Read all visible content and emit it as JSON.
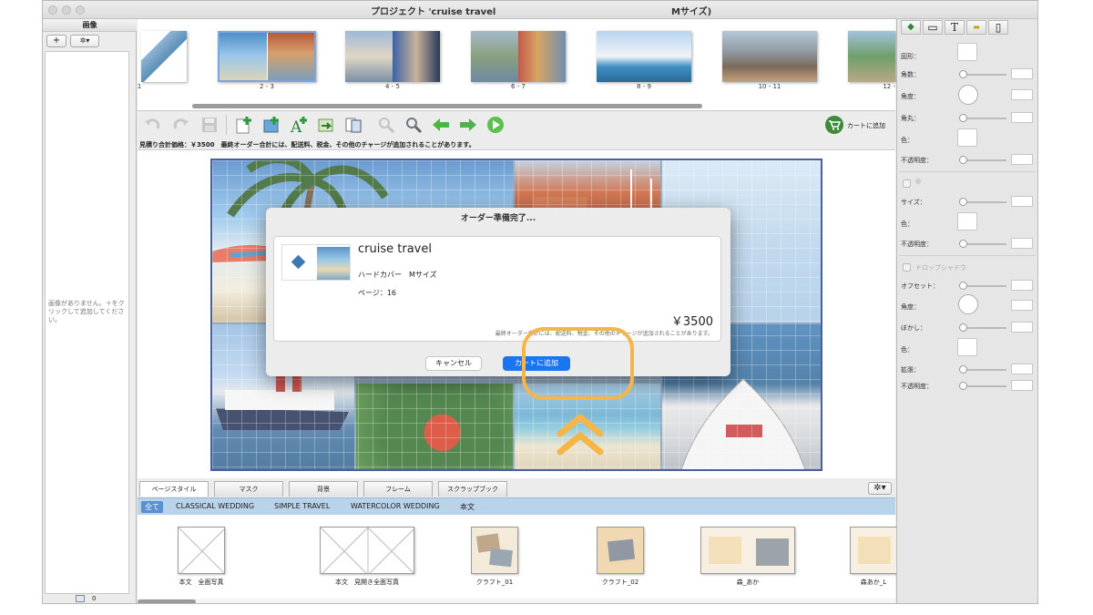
{
  "window": {
    "title": "プロジェクト 'cruise travel",
    "size_label": "Mサイズ)"
  },
  "left_panel": {
    "header": "画像",
    "add_btn": "+",
    "gear_btn": "✲▾",
    "empty_message": "画像がありません。＋をクリックして追加してください。",
    "count": "0"
  },
  "pages_strip": {
    "pages": [
      {
        "label": "1"
      },
      {
        "label": "2 - 3"
      },
      {
        "label": "4 - 5"
      },
      {
        "label": "6 - 7"
      },
      {
        "label": "8 - 9"
      },
      {
        "label": "10 - 11"
      },
      {
        "label": "12 -"
      }
    ]
  },
  "toolbar": {
    "cart_label": "カートに追加",
    "notice": "見積り合計価格：￥3500　最終オーダー合計には、配送料、税金、その他のチャージが追加されることがあります。"
  },
  "dialog": {
    "title": "オーダー準備完了...",
    "project_name": "cruise travel",
    "cover": "ハードカバー　Mサイズ",
    "pages": "ページ：16",
    "price": "￥3500",
    "note": "最終オーダー合計には、配送料、税金、その他のチャージが追加されることがあります。",
    "cancel": "キャンセル",
    "add_to_cart": "カートに追加"
  },
  "bottom_tabs": [
    {
      "label": "ページスタイル"
    },
    {
      "label": "マスク"
    },
    {
      "label": "背景"
    },
    {
      "label": "フレーム"
    },
    {
      "label": "スクラップブック"
    }
  ],
  "filters": {
    "selected": "全て",
    "items": [
      "CLASSICAL WEDDING",
      "SIMPLE TRAVEL",
      "WATERCOLOR WEDDING",
      "本文"
    ]
  },
  "styles": [
    {
      "caption": "本文　全面写真"
    },
    {
      "caption": "本文　見開き全面写真"
    },
    {
      "caption": "クラフト_01"
    },
    {
      "caption": "クラフト_02"
    },
    {
      "caption": "森_あか"
    },
    {
      "caption": "森あか_L"
    }
  ],
  "inspector": {
    "shape": "図形：",
    "corners": "角数：",
    "angle": "角度：",
    "round": "角丸：",
    "color": "色：",
    "opacity": "不透明度：",
    "size": "サイズ：",
    "color2": "色：",
    "opacity2": "不透明度：",
    "drop_shadow": "ドロップシャドウ",
    "offset": "オフセット：",
    "angle2": "角度：",
    "blur": "ぼかし：",
    "color3": "色：",
    "spread": "拡張：",
    "opacity3": "不透明度："
  },
  "colors": {
    "accent_blue": "#1a75f0",
    "highlight_orange": "#f5b548",
    "filter_bar": "#b9d3ea"
  }
}
